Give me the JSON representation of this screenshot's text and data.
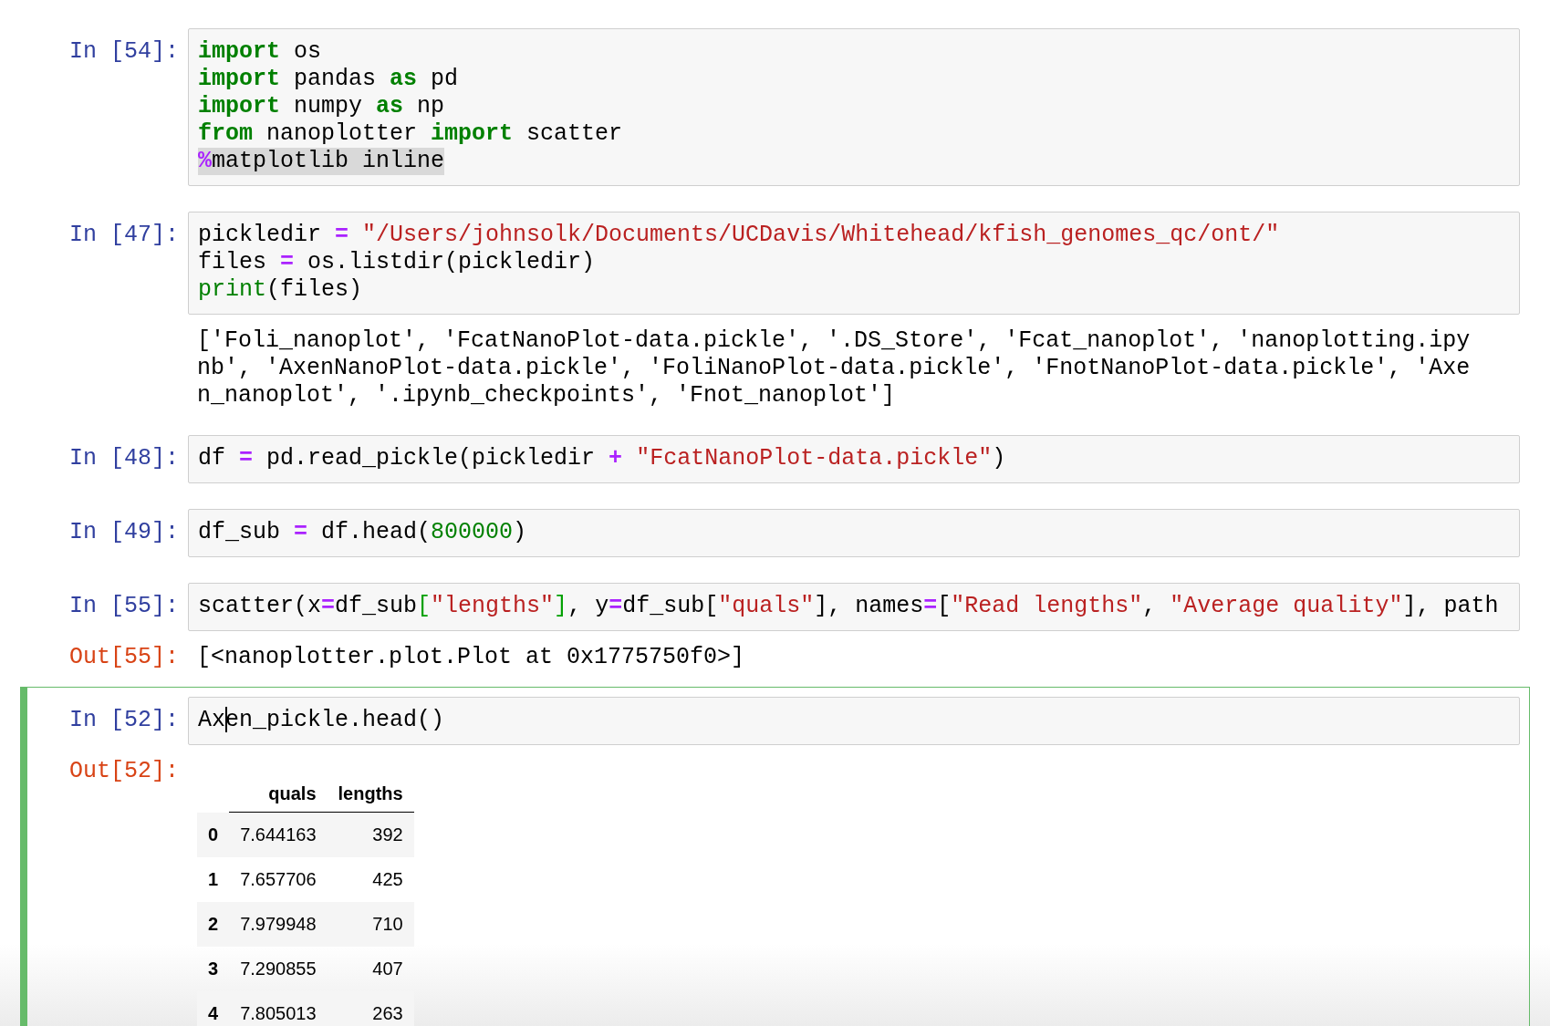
{
  "cells": [
    {
      "prompt": "In [54]:",
      "selected": false,
      "lines": [
        {
          "highlighted": false,
          "tokens": [
            {
              "kind": "kw",
              "text": "import"
            },
            {
              "kind": "plain",
              "text": " os"
            }
          ]
        },
        {
          "highlighted": false,
          "tokens": [
            {
              "kind": "kw",
              "text": "import"
            },
            {
              "kind": "plain",
              "text": " pandas "
            },
            {
              "kind": "kw",
              "text": "as"
            },
            {
              "kind": "plain",
              "text": " pd"
            }
          ]
        },
        {
          "highlighted": false,
          "tokens": [
            {
              "kind": "kw",
              "text": "import"
            },
            {
              "kind": "plain",
              "text": " numpy "
            },
            {
              "kind": "kw",
              "text": "as"
            },
            {
              "kind": "plain",
              "text": " np"
            }
          ]
        },
        {
          "highlighted": false,
          "tokens": [
            {
              "kind": "kw",
              "text": "from"
            },
            {
              "kind": "plain",
              "text": " nanoplotter "
            },
            {
              "kind": "kw",
              "text": "import"
            },
            {
              "kind": "plain",
              "text": " scatter"
            }
          ]
        },
        {
          "highlighted": true,
          "tokens": [
            {
              "kind": "op",
              "text": "%"
            },
            {
              "kind": "plain",
              "text": "matplotlib inline"
            }
          ]
        }
      ]
    },
    {
      "prompt": "In [47]:",
      "selected": false,
      "lines": [
        {
          "highlighted": false,
          "tokens": [
            {
              "kind": "plain",
              "text": "pickledir "
            },
            {
              "kind": "op",
              "text": "="
            },
            {
              "kind": "str",
              "text": " \"/Users/johnsolk/Documents/UCDavis/Whitehead/kfish_genomes_qc/ont/\""
            }
          ]
        },
        {
          "highlighted": false,
          "tokens": [
            {
              "kind": "plain",
              "text": "files "
            },
            {
              "kind": "op",
              "text": "="
            },
            {
              "kind": "plain",
              "text": " os.listdir(pickledir)"
            }
          ]
        },
        {
          "highlighted": false,
          "tokens": [
            {
              "kind": "builtin",
              "text": "print"
            },
            {
              "kind": "plain",
              "text": "(files)"
            }
          ]
        }
      ],
      "outputs": [
        {
          "kind": "text",
          "lines": [
            "['Foli_nanoplot', 'FcatNanoPlot-data.pickle', '.DS_Store', 'Fcat_nanoplot', 'nanoplotting.ipy",
            "nb', 'AxenNanoPlot-data.pickle', 'FoliNanoPlot-data.pickle', 'FnotNanoPlot-data.pickle', 'Axe",
            "n_nanoplot', '.ipynb_checkpoints', 'Fnot_nanoplot']"
          ]
        }
      ]
    },
    {
      "prompt": "In [48]:",
      "selected": false,
      "lines": [
        {
          "highlighted": false,
          "tokens": [
            {
              "kind": "plain",
              "text": "df "
            },
            {
              "kind": "op",
              "text": "="
            },
            {
              "kind": "plain",
              "text": " pd.read_pickle(pickledir "
            },
            {
              "kind": "op",
              "text": "+"
            },
            {
              "kind": "str",
              "text": " \"FcatNanoPlot-data.pickle\""
            },
            {
              "kind": "plain",
              "text": ")"
            }
          ]
        }
      ]
    },
    {
      "prompt": "In [49]:",
      "selected": false,
      "lines": [
        {
          "highlighted": false,
          "tokens": [
            {
              "kind": "plain",
              "text": "df_sub "
            },
            {
              "kind": "op",
              "text": "="
            },
            {
              "kind": "plain",
              "text": " df.head("
            },
            {
              "kind": "num",
              "text": "800000"
            },
            {
              "kind": "plain",
              "text": ")"
            }
          ]
        }
      ]
    },
    {
      "prompt": "In [55]:",
      "selected": false,
      "lines": [
        {
          "highlighted": false,
          "tokens": [
            {
              "kind": "plain",
              "text": "scatter(x"
            },
            {
              "kind": "op",
              "text": "="
            },
            {
              "kind": "plain",
              "text": "df_sub"
            },
            {
              "kind": "bracket",
              "text": "["
            },
            {
              "kind": "str",
              "text": "\"lengths\""
            },
            {
              "kind": "bracket",
              "text": "]"
            },
            {
              "kind": "plain",
              "text": ", y"
            },
            {
              "kind": "op",
              "text": "="
            },
            {
              "kind": "plain",
              "text": "df_sub["
            },
            {
              "kind": "str",
              "text": "\"quals\""
            },
            {
              "kind": "plain",
              "text": "], names"
            },
            {
              "kind": "op",
              "text": "="
            },
            {
              "kind": "plain",
              "text": "["
            },
            {
              "kind": "str",
              "text": "\"Read lengths\""
            },
            {
              "kind": "plain",
              "text": ", "
            },
            {
              "kind": "str",
              "text": "\"Average quality\""
            },
            {
              "kind": "plain",
              "text": "], path"
            }
          ]
        }
      ],
      "outputs": [
        {
          "kind": "text",
          "prompt": "Out[55]:",
          "lines": [
            "[<nanoplotter.plot.Plot at 0x1775750f0>]"
          ]
        }
      ]
    },
    {
      "prompt": "In [52]:",
      "selected": true,
      "lines": [
        {
          "highlighted": false,
          "tokens": [
            {
              "kind": "plain",
              "text": "Ax"
            },
            {
              "kind": "cursor"
            },
            {
              "kind": "plain",
              "text": "en_pickle.head()"
            }
          ]
        }
      ],
      "outputs": [
        {
          "kind": "table",
          "prompt": "Out[52]:",
          "columns": [
            "quals",
            "lengths"
          ],
          "rows": [
            {
              "index": "0",
              "cells": [
                "7.644163",
                "392"
              ]
            },
            {
              "index": "1",
              "cells": [
                "7.657706",
                "425"
              ]
            },
            {
              "index": "2",
              "cells": [
                "7.979948",
                "710"
              ]
            },
            {
              "index": "3",
              "cells": [
                "7.290855",
                "407"
              ]
            },
            {
              "index": "4",
              "cells": [
                "7.805013",
                "263"
              ]
            }
          ]
        }
      ]
    }
  ]
}
